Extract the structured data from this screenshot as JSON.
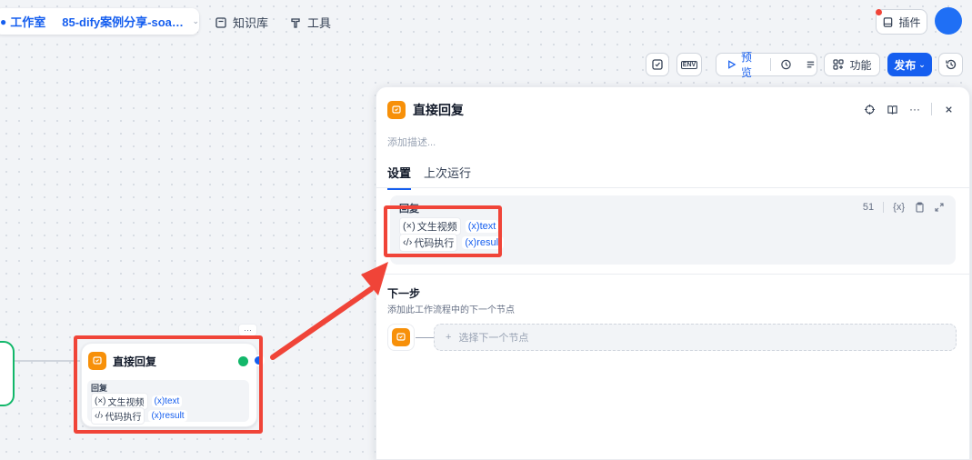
{
  "header": {
    "workspace": "工作室",
    "app_name": "85-dify案例分享-soar...",
    "nav": [
      {
        "label": "知识库",
        "icon": "book-icon"
      },
      {
        "label": "工具",
        "icon": "tool-icon"
      }
    ],
    "plugin_label": "插件"
  },
  "toolbar": {
    "env_label": "ENV",
    "preview_label": "预览",
    "features_label": "功能",
    "publish_label": "发布"
  },
  "panel": {
    "title": "直接回复",
    "description_placeholder": "添加描述...",
    "tabs": [
      "设置",
      "上次运行"
    ],
    "reply": {
      "label": "回复",
      "char_count": "51",
      "var_button": "{x}",
      "variables": [
        {
          "source": "文生视频",
          "source_icon": "variable-icon",
          "var": "text"
        },
        {
          "source": "代码执行",
          "source_icon": "code-icon",
          "var": "result"
        }
      ]
    },
    "next_step": {
      "title": "下一步",
      "description": "添加此工作流程中的下一个节点",
      "select_label": "选择下一个节点"
    }
  },
  "canvas_node": {
    "title": "直接回复",
    "label": "回复",
    "variables": [
      {
        "source": "文生视频",
        "var": "text"
      },
      {
        "source": "代码执行",
        "var": "result"
      }
    ]
  },
  "colors": {
    "accent": "#155eef",
    "node_orange": "#f79009",
    "highlight_red": "#f04438",
    "success": "#12b76a"
  }
}
